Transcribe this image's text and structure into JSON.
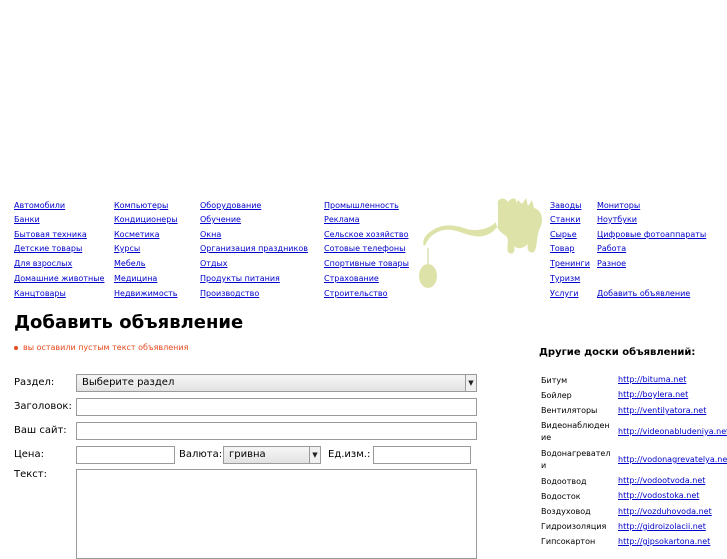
{
  "categories": {
    "col1": [
      "Автомобили",
      "Банки",
      "Бытовая техника",
      "Детские товары",
      "Для взрослых",
      "Домашние животные",
      "Канцтовары"
    ],
    "col2": [
      "Компьютеры",
      "Кондиционеры",
      "Косметика",
      "Курсы",
      "Мебель",
      "Медицина",
      "Недвижимость"
    ],
    "col3": [
      "Оборудование",
      "Обучение",
      "Окна",
      "Организация праздников",
      "Отдых",
      "Продукты питания",
      "Производство"
    ],
    "col4": [
      "Промышленность",
      "Реклама",
      "Сельское хозяйство",
      "Сотовые телефоны",
      "Спортивные товары",
      "Страхование",
      "Строительство"
    ],
    "col5": [
      "Заводы",
      "Станки",
      "Сырье",
      "Товар",
      "Тренинги",
      "Туризм",
      "Услуги"
    ],
    "col6": [
      "Мониторы",
      "Ноутбуки",
      "Цифровые фотоаппараты",
      "Работа",
      "Разное",
      "",
      "Добавить объявление"
    ]
  },
  "form": {
    "title": "Добавить объявление",
    "error": "вы оставили пустым текст объявления",
    "section_label": "Раздел:",
    "section_value": "Выберите раздел",
    "heading_label": "Заголовок:",
    "heading_value": "",
    "site_label": "Ваш сайт:",
    "site_value": "",
    "price_label": "Цена:",
    "price_value": "",
    "currency_label": "Валюта:",
    "currency_value": "гривна",
    "unit_label": "Ед.изм.:",
    "unit_value": "",
    "text_label": "Текст:",
    "text_value": ""
  },
  "sidebar": {
    "title": "Другие доски объявлений:",
    "boards": [
      {
        "name": "Битум",
        "url": "http://bituma.net"
      },
      {
        "name": "Бойлер",
        "url": "http://boylera.net"
      },
      {
        "name": "Вентиляторы",
        "url": "http://ventilyatora.net"
      },
      {
        "name": "Видеонаблюдение",
        "url": "http://videonabludeniya.net"
      },
      {
        "name": "Водонагреватели",
        "url": "http://vodonagrevatelya.net"
      },
      {
        "name": "Водоотвод",
        "url": "http://vodootvoda.net"
      },
      {
        "name": "Водосток",
        "url": "http://vodostoka.net"
      },
      {
        "name": "Воздуховод",
        "url": "http://vozduhovoda.net"
      },
      {
        "name": "Гидроизоляция",
        "url": "http://gidroizolacii.net"
      },
      {
        "name": "Гипсокартон",
        "url": "http://gipsokartona.net"
      }
    ]
  },
  "colors": {
    "link": "#0000cc",
    "error": "#e8491d",
    "decoration": "#dde3a8"
  }
}
